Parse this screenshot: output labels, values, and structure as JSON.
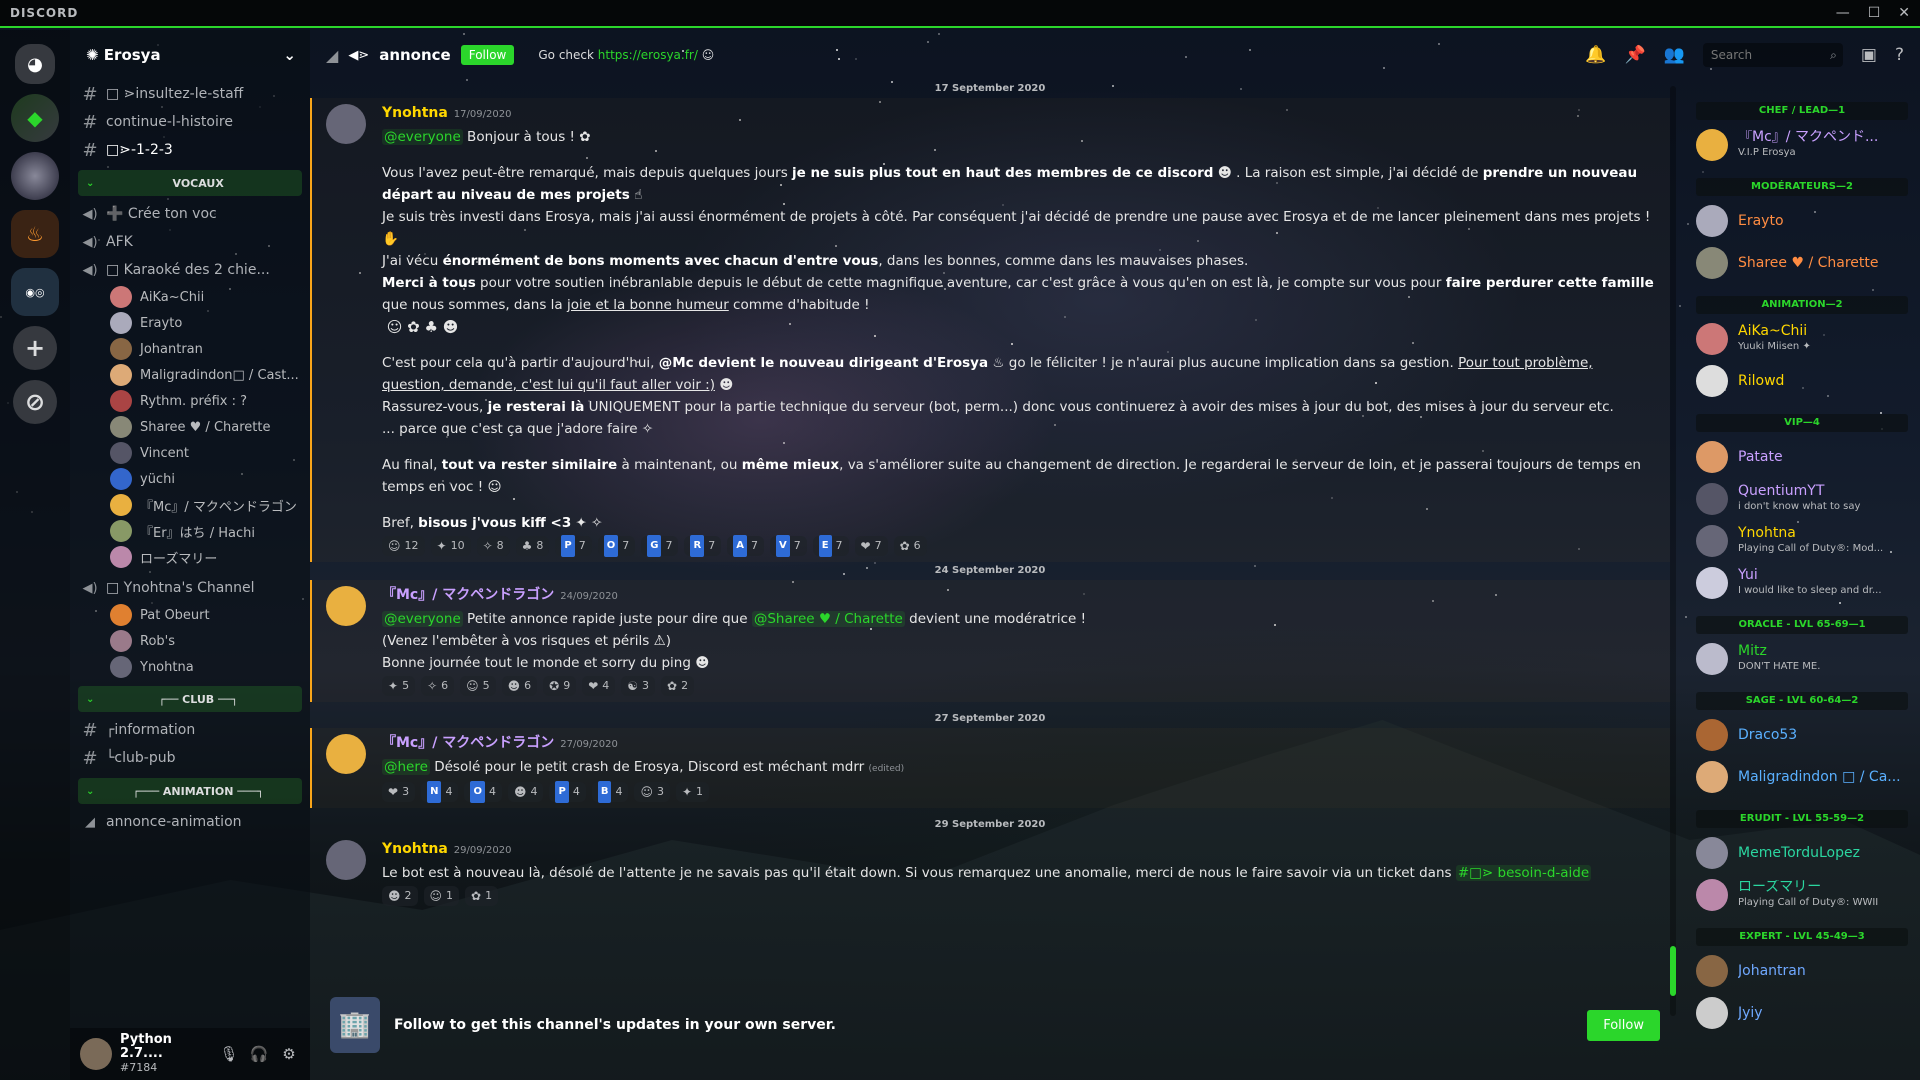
{
  "window": {
    "brand": "DISCORD",
    "controls": [
      "—",
      "☐",
      "✕"
    ]
  },
  "server": {
    "name": "Erosya"
  },
  "channels": {
    "top": [
      {
        "name": "□ ⋗insultez-le-staff"
      },
      {
        "name": "continue-l-histoire"
      },
      {
        "name": "□⋗-1-2-3"
      }
    ],
    "cat_vocaux": "VOCAUX",
    "voice": [
      {
        "name": "➕ Crée ton voc"
      },
      {
        "name": "AFK"
      },
      {
        "name": "□ Karaoké des 2 chie..."
      }
    ],
    "karaoke_users": [
      {
        "name": "AiKa~Chii",
        "color": "#c77"
      },
      {
        "name": "Erayto",
        "color": "#aab"
      },
      {
        "name": "Johantran",
        "color": "#864"
      },
      {
        "name": "Maligradindon□ / Cast...",
        "color": "#da7"
      },
      {
        "name": "Rythm. préfix : ?",
        "color": "#a44"
      },
      {
        "name": "Sharee ♥ / Charette",
        "color": "#887"
      },
      {
        "name": "Vincent",
        "color": "#556"
      },
      {
        "name": "yüchi",
        "color": "#36c"
      },
      {
        "name": "『Mc』/ マクペンドラゴン",
        "color": "#e9b040"
      },
      {
        "name": "『Er』はち / Hachi",
        "color": "#896"
      },
      {
        "name": "ローズマリー",
        "color": "#b8a"
      }
    ],
    "channel_yno": "□ Ynohtna's Channel",
    "yno_users": [
      {
        "name": "Pat Obeurt",
        "color": "#e08030"
      },
      {
        "name": "Rob's",
        "color": "#9a7a8a"
      },
      {
        "name": "Ynohtna",
        "color": "#667"
      }
    ],
    "cat_club": "┌── CLUB ──┐",
    "club": [
      {
        "name": "┌information"
      },
      {
        "name": "└club-pub"
      }
    ],
    "cat_anim": "┌─── ANIMATION ───┐",
    "anim": [
      {
        "name": "annonce-animation"
      }
    ]
  },
  "user": {
    "name": "Python 2.7....",
    "tag": "#7184"
  },
  "header": {
    "channel": "annonce",
    "follow": "Follow",
    "topic_prefix": "Go check ",
    "topic_link": "https://erosya.fr/",
    "search_placeholder": "Search"
  },
  "dates": {
    "d1": "17 September 2020",
    "d2": "24 September 2020",
    "d3": "27 September 2020",
    "d4": "29 September 2020"
  },
  "messages": {
    "m1": {
      "author": "Ynohtna",
      "ts": "17/09/2020",
      "l1_mention": "@everyone",
      "l1": " Bonjour à tous !",
      "p1a": "Vous l'avez peut-être remarqué, mais depuis quelques jours ",
      "p1b": "je ne suis plus tout en haut des membres de ce discord",
      "p1c": " . La raison est simple, j'ai décidé de ",
      "p1d": "prendre un nouveau départ au niveau de mes projets",
      "p2": "Je suis très investi dans Erosya, mais j'ai aussi énormément de projets à côté. Par conséquent j'ai décidé de prendre une pause avec Erosya et de me lancer pleinement dans mes projets !",
      "p3a": "J'ai vécu ",
      "p3b": "énormément de bons moments avec chacun d'entre vous",
      "p3c": ", dans les bonnes, comme dans les mauvaises phases.",
      "p4a": "Merci à tous",
      "p4b": " pour votre soutien inébranlable depuis le début de cette magnifique aventure, car c'est grâce à vous qu'en on est là, je compte sur vous pour ",
      "p4c": "faire perdurer cette famille",
      "p4d": " que nous sommes, dans la ",
      "p4e": "joie et la bonne humeur",
      "p4f": " comme d'habitude !",
      "p5a": "C'est pour cela qu'à partir d'aujourd'hui, ",
      "p5b": "@Mc devient le nouveau dirigeant d'Erosya",
      "p5c": " go le féliciter ! je n'aurai plus aucune implication dans sa gestion. ",
      "p5d": "Pour tout problème, question, demande, c'est lui qu'il faut aller voir :)",
      "p6a": "Rassurez-vous, ",
      "p6b": "je resterai là",
      "p6c": " UNIQUEMENT pour la partie technique du serveur (bot, perm...) donc vous continuerez à avoir des mises à jour du bot, des mises à jour du serveur etc.",
      "p7": "... parce que c'est ça que j'adore faire",
      "p8a": "Au final, ",
      "p8b": "tout va rester similaire",
      "p8c": " à maintenant, ou ",
      "p8d": "même mieux",
      "p8e": ", va s'améliorer suite au changement de direction. Je regarderai le serveur de loin, et je passerai toujours de temps en temps en voc !",
      "p9a": "Bref, ",
      "p9b": "bisous j'vous kiff <3",
      "reacts": [
        {
          "e": "☺",
          "n": "12"
        },
        {
          "e": "✦",
          "n": "10"
        },
        {
          "e": "✧",
          "n": "8"
        },
        {
          "e": "♣",
          "n": "8"
        },
        {
          "l": "P",
          "n": "7"
        },
        {
          "l": "O",
          "n": "7"
        },
        {
          "l": "G",
          "n": "7"
        },
        {
          "l": "R",
          "n": "7"
        },
        {
          "l": "A",
          "n": "7"
        },
        {
          "l": "V",
          "n": "7"
        },
        {
          "l": "E",
          "n": "7"
        },
        {
          "e": "❤",
          "n": "7"
        },
        {
          "e": "✿",
          "n": "6"
        }
      ]
    },
    "m2": {
      "author": "『Mc』/ マクペンドラゴン",
      "ts": "24/09/2020",
      "mention1": "@everyone",
      "l1a": " Petite annonce rapide juste pour dire que ",
      "mention2": "@Sharee ♥ / Charette",
      "l1b": " devient une modératrice !",
      "l2": "(Venez l'embêter à vos risques et périls ⚠)",
      "l3": "Bonne journée tout le monde et sorry du ping",
      "reacts": [
        {
          "e": "✦",
          "n": "5"
        },
        {
          "e": "✧",
          "n": "6"
        },
        {
          "e": "☺",
          "n": "5"
        },
        {
          "e": "☻",
          "n": "6"
        },
        {
          "e": "✪",
          "n": "9"
        },
        {
          "e": "❤",
          "n": "4"
        },
        {
          "e": "☯",
          "n": "3"
        },
        {
          "e": "✿",
          "n": "2"
        }
      ]
    },
    "m3": {
      "author": "『Mc』/ マクペンドラゴン",
      "ts": "27/09/2020",
      "mention": "@here",
      "l1": " Désolé pour le petit crash de Erosya, Discord est méchant mdrr",
      "edited": "(edited)",
      "reacts": [
        {
          "e": "❤",
          "n": "3"
        },
        {
          "l": "N",
          "n": "4"
        },
        {
          "l": "O",
          "n": "4"
        },
        {
          "e": "☻",
          "n": "4"
        },
        {
          "l": "P",
          "n": "4"
        },
        {
          "l": "B",
          "n": "4"
        },
        {
          "e": "☺",
          "n": "3"
        },
        {
          "e": "✦",
          "n": "1"
        }
      ]
    },
    "m4": {
      "author": "Ynohtna",
      "ts": "29/09/2020",
      "l1": "Le bot est à nouveau là, désolé de l'attente je ne savais pas qu'il était down. Si vous remarquez une anomalie, merci de nous le faire savoir via un ticket dans ",
      "channel": "#□⋗ besoin-d-aide",
      "reacts": [
        {
          "e": "☻",
          "n": "2"
        },
        {
          "e": "☺",
          "n": "1"
        },
        {
          "e": "✿",
          "n": "1"
        }
      ]
    }
  },
  "followbar": {
    "text": "Follow to get this channel's updates in your own server.",
    "button": "Follow"
  },
  "members": [
    {
      "role": "CHEF / LEAD—1",
      "list": [
        {
          "name": "『Mc』/ マクペンド...",
          "status": "V.I.P Erosya",
          "color": "#c9a0ff",
          "av": "#e9b040"
        }
      ]
    },
    {
      "role": "MODÉRATEURS—2",
      "list": [
        {
          "name": "Erayto",
          "status": "",
          "color": "#ff8c42",
          "av": "#aab"
        },
        {
          "name": "Sharee ♥ / Charette",
          "status": "",
          "color": "#ff8c42",
          "av": "#887"
        }
      ]
    },
    {
      "role": "ANIMATION—2",
      "list": [
        {
          "name": "AiKa~Chii",
          "status": "Yuuki Miisen ✦",
          "color": "#ffd700",
          "av": "#c77"
        },
        {
          "name": "Rilowd",
          "status": "",
          "color": "#ffd700",
          "av": "#ddd"
        }
      ]
    },
    {
      "role": "VIP—4",
      "list": [
        {
          "name": "Patate",
          "status": "",
          "color": "#c9a0ff",
          "av": "#d96"
        },
        {
          "name": "QuentiumYT",
          "status": "i don't know what to say",
          "color": "#c9a0ff",
          "av": "#556"
        },
        {
          "name": "Ynohtna",
          "status": "Playing Call of Duty®: Mod...",
          "color": "#ffd700",
          "av": "#667"
        },
        {
          "name": "Yui",
          "status": "I would like to sleep and dr...",
          "color": "#c9a0ff",
          "av": "#ccd"
        }
      ]
    },
    {
      "role": "ORACLE - LVL 65-69—1",
      "list": [
        {
          "name": "Mitz",
          "status": "DON'T HATE ME.",
          "color": "#2bd62b",
          "av": "#bbc"
        }
      ]
    },
    {
      "role": "SAGE - LVL 60-64—2",
      "list": [
        {
          "name": "Draco53",
          "status": "",
          "color": "#5ab0ff",
          "av": "#a63"
        },
        {
          "name": "Maligradindon □ / Ca...",
          "status": "",
          "color": "#5ab0ff",
          "av": "#da7"
        }
      ]
    },
    {
      "role": "ERUDIT - LVL 55-59—2",
      "list": [
        {
          "name": "MemeTorduLopez",
          "status": "",
          "color": "#2bd6a0",
          "av": "#889"
        },
        {
          "name": "ローズマリー",
          "status": "Playing Call of Duty®: WWII",
          "color": "#2bd6a0",
          "av": "#b8a"
        }
      ]
    },
    {
      "role": "EXPERT - LVL 45-49—3",
      "list": [
        {
          "name": "Johantran",
          "status": "",
          "color": "#6fa8ff",
          "av": "#864"
        },
        {
          "name": "Jyiy",
          "status": "",
          "color": "#6fa8ff",
          "av": "#ccc"
        }
      ]
    }
  ]
}
